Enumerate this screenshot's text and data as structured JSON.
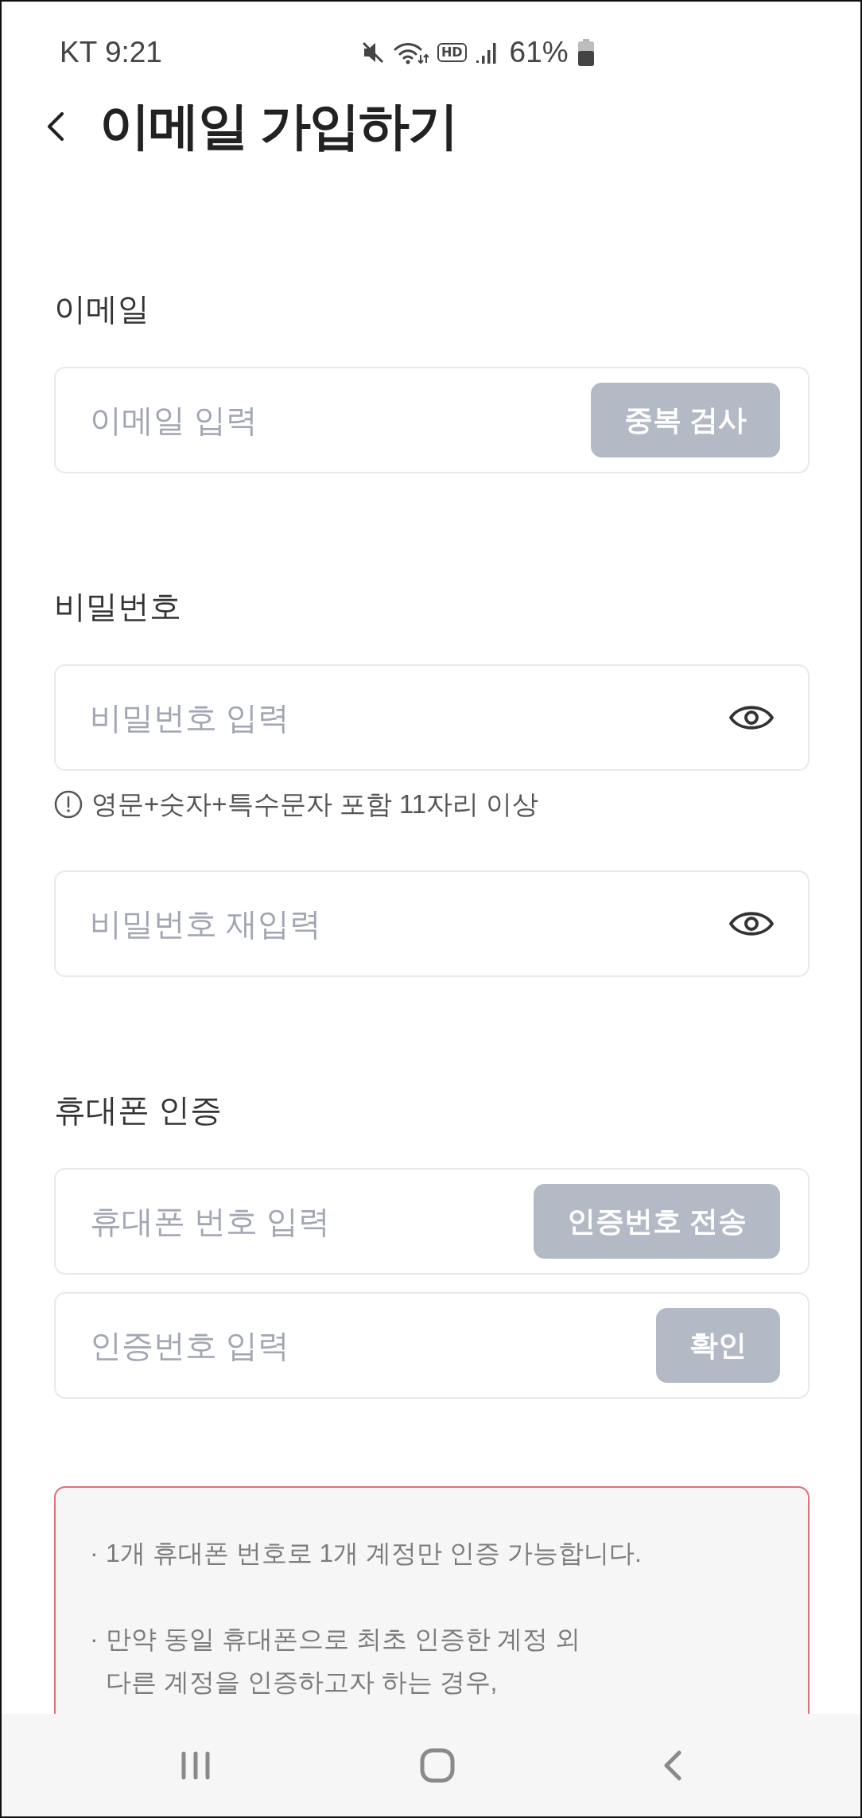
{
  "status_bar": {
    "carrier_time": "KT 9:21",
    "hd_label": "HD",
    "battery_percent": "61%"
  },
  "header": {
    "title": "이메일 가입하기"
  },
  "sections": [
    {
      "label": "이메일",
      "fields": [
        {
          "kind": "action",
          "placeholder": "이메일 입력",
          "button": {
            "label": "중복 검사",
            "disabled": true
          }
        }
      ]
    },
    {
      "label": "비밀번호",
      "fields": [
        {
          "kind": "password",
          "placeholder": "비밀번호 입력",
          "hint": "영문+숫자+특수문자 포함 11자리 이상"
        },
        {
          "kind": "password",
          "placeholder": "비밀번호 재입력"
        }
      ]
    },
    {
      "label": "휴대폰 인증",
      "fields": [
        {
          "kind": "action",
          "placeholder": "휴대폰 번호 입력",
          "button": {
            "label": "인증번호 전송",
            "disabled": true
          }
        },
        {
          "kind": "action",
          "placeholder": "인증번호 입력",
          "button": {
            "label": "확인",
            "disabled": true
          }
        }
      ]
    }
  ],
  "notice": {
    "items": [
      {
        "bullet": "·",
        "text": "1개 휴대폰 번호로 1개 계정만 인증 가능합니다."
      },
      {
        "bullet": "·",
        "text": "만약 동일 휴대폰으로 최초 인증한 계정 외\n다른 계정을 인증하고자 하는 경우,"
      }
    ]
  }
}
